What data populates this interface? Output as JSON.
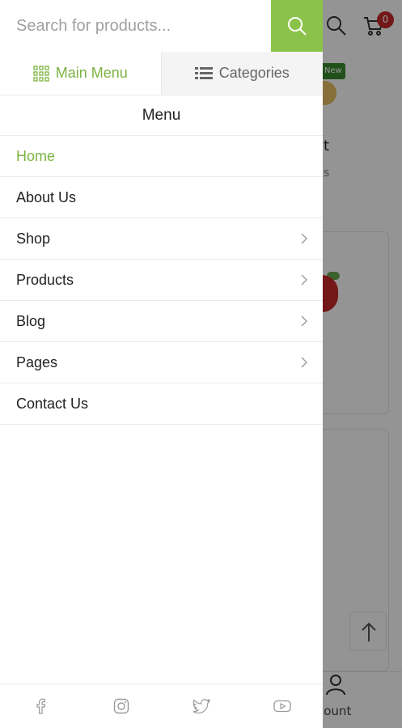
{
  "search": {
    "placeholder": "Search for products..."
  },
  "tabs": [
    {
      "label": "Main Menu",
      "active": true
    },
    {
      "label": "Categories",
      "active": false
    }
  ],
  "menu": {
    "heading": "Menu",
    "items": [
      {
        "label": "Home",
        "active": true,
        "has_submenu": false
      },
      {
        "label": "About Us",
        "active": false,
        "has_submenu": false
      },
      {
        "label": "Shop",
        "active": false,
        "has_submenu": true
      },
      {
        "label": "Products",
        "active": false,
        "has_submenu": true
      },
      {
        "label": "Blog",
        "active": false,
        "has_submenu": true
      },
      {
        "label": "Pages",
        "active": false,
        "has_submenu": true
      },
      {
        "label": "Contact Us",
        "active": false,
        "has_submenu": false
      }
    ]
  },
  "social": [
    "facebook-icon",
    "instagram-icon",
    "twitter-icon",
    "youtube-icon"
  ],
  "background": {
    "cart_count": "0",
    "new_badge": "New",
    "product_text_1": "t",
    "product_text_2": "s",
    "account_label": "count"
  },
  "colors": {
    "accent": "#8bc34a",
    "accent_text": "#7cb342",
    "badge": "#c62828"
  }
}
